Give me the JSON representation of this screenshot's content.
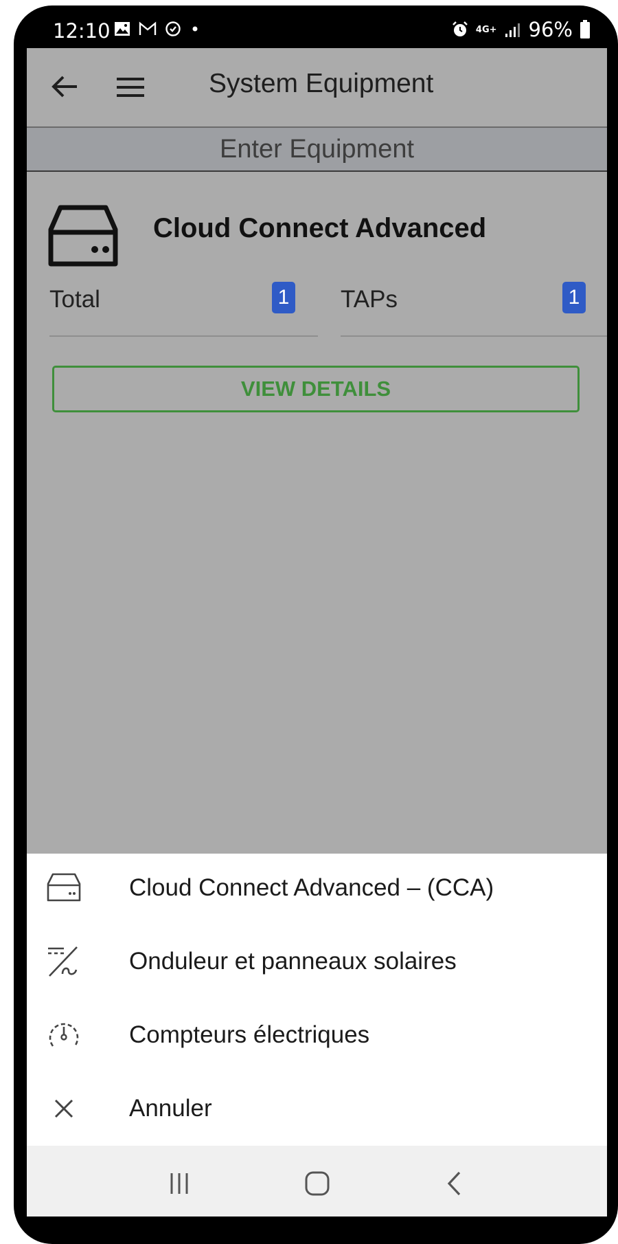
{
  "status_bar": {
    "time": "12:10",
    "network": "4G+",
    "battery": "96%",
    "icons": [
      "image-icon",
      "gmail-icon",
      "sync-icon",
      "dot-icon",
      "alarm-icon",
      "signal-icon",
      "battery-icon"
    ]
  },
  "appbar": {
    "title": "System Equipment",
    "back_icon": "arrow-left-icon",
    "menu_icon": "hamburger-menu-icon"
  },
  "subheader": "Enter Equipment",
  "device": {
    "name": "Cloud Connect Advanced",
    "icon": "hard-drive-icon",
    "stats": [
      {
        "label": "Total",
        "count": "1"
      },
      {
        "label": "TAPs",
        "count": "1"
      }
    ],
    "button_label": "VIEW DETAILS"
  },
  "bottom_sheet": {
    "items": [
      {
        "label": "Cloud Connect Advanced – (CCA)",
        "icon": "hard-drive-icon"
      },
      {
        "label": "Onduleur et panneaux solaires",
        "icon": "solar-inverter-icon"
      },
      {
        "label": "Compteurs électriques",
        "icon": "gauge-icon"
      },
      {
        "label": "Annuler",
        "icon": "close-icon"
      }
    ]
  },
  "navbar": {
    "buttons": [
      "recent-apps-icon",
      "home-icon",
      "back-icon"
    ]
  },
  "colors": {
    "overlay": "#ababab",
    "subheader_bg": "#9d9fa3",
    "badge": "#2f5bc6",
    "button_green": "#3f8f3b"
  }
}
